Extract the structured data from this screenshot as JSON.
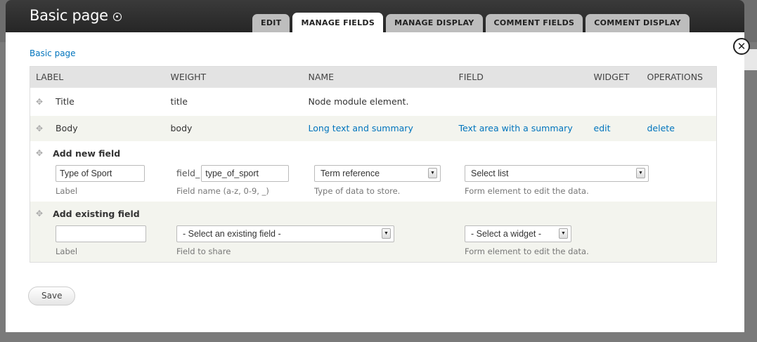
{
  "header": {
    "title": "Basic page",
    "tabs": [
      {
        "label": "EDIT",
        "active": false
      },
      {
        "label": "MANAGE FIELDS",
        "active": true
      },
      {
        "label": "MANAGE DISPLAY",
        "active": false
      },
      {
        "label": "COMMENT FIELDS",
        "active": false
      },
      {
        "label": "COMMENT DISPLAY",
        "active": false
      }
    ]
  },
  "breadcrumb": "Basic page",
  "table": {
    "columns": [
      "LABEL",
      "WEIGHT",
      "NAME",
      "FIELD",
      "WIDGET",
      "OPERATIONS"
    ],
    "rows": [
      {
        "label": "Title",
        "name": "title",
        "field": "Node module element.",
        "widget": "",
        "edit": "",
        "delete": ""
      },
      {
        "label": "Body",
        "name": "body",
        "field": "Long text and summary",
        "widget": "Text area with a summary",
        "edit": "edit",
        "delete": "delete"
      }
    ],
    "add_new": {
      "heading": "Add new field",
      "label_value": "Type of Sport",
      "label_desc": "Label",
      "name_prefix": "field_",
      "name_value": "type_of_sport",
      "name_desc": "Field name (a-z, 0-9, _)",
      "type_value": "Term reference",
      "type_desc": "Type of data to store.",
      "widget_value": "Select list",
      "widget_desc": "Form element to edit the data."
    },
    "add_existing": {
      "heading": "Add existing field",
      "label_value": "",
      "label_desc": "Label",
      "field_value": "- Select an existing field -",
      "field_desc": "Field to share",
      "widget_value": "- Select a widget -",
      "widget_desc": "Form element to edit the data."
    }
  },
  "actions": {
    "save_label": "Save"
  },
  "icons": {
    "close": "close-icon",
    "drag": "drag-handle-icon",
    "title": "gear-icon"
  },
  "colors": {
    "link": "#0074bd",
    "header": "#2e2e2e",
    "tab": "#bdbdbd"
  }
}
